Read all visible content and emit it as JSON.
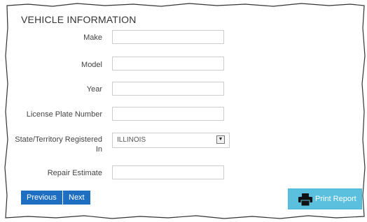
{
  "section": {
    "title": "VEHICLE INFORMATION"
  },
  "fields": {
    "make": {
      "label": "Make",
      "value": ""
    },
    "model": {
      "label": "Model",
      "value": ""
    },
    "year": {
      "label": "Year",
      "value": ""
    },
    "license_plate": {
      "label": "License Plate Number",
      "value": ""
    },
    "state": {
      "label": "State/Territory Registered In",
      "selected": "ILLINOIS"
    },
    "repair_estimate": {
      "label": "Repair Estimate",
      "value": ""
    }
  },
  "buttons": {
    "previous": "Previous",
    "next": "Next",
    "print_report": "Print Report"
  },
  "icons": {
    "print": "printer-icon",
    "dropdown": "chevron-down-icon"
  },
  "colors": {
    "primary_button": "#1e6fc2",
    "print_button": "#5bc0de",
    "field_border": "#cccccc"
  }
}
